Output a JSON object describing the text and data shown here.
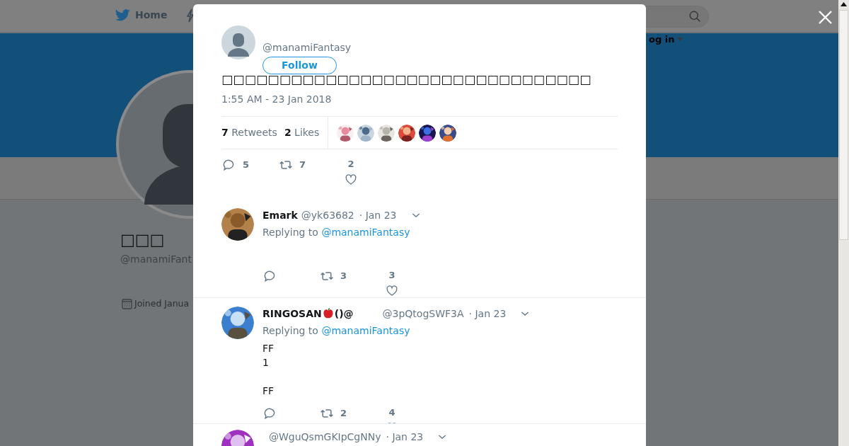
{
  "nav": {
    "home": "Home",
    "login": "og in"
  },
  "profile": {
    "name": "□□□",
    "handle": "@manamiFant",
    "joined": "Joined Janua"
  },
  "tweet": {
    "handle": "@manamiFantasy",
    "follow": "Follow",
    "text": "□□□□□□□□□□□□□□□□□□□□□□□□□□□□□□□□",
    "time": "1:55 AM - 23 Jan 2018",
    "stats": [
      {
        "count": "7",
        "label": "Retweets"
      },
      {
        "count": "2",
        "label": "Likes"
      }
    ],
    "actions": {
      "replies": "5",
      "retweets": "7",
      "likes": "2"
    }
  },
  "replies": [
    {
      "name": [
        "Emark"
      ],
      "handle": "@yk63682",
      "date": "· Jan 23",
      "replying_label": "Replying to",
      "replying_to": "@manamiFantasy",
      "actions": {
        "retweets": "3",
        "likes": "3"
      }
    },
    {
      "name": [
        "RINGOSAN",
        "()@"
      ],
      "handle": "@3pQtogSWF3A",
      "date": "· Jan 23",
      "replying_label": "Replying to",
      "replying_to": "@manamiFantasy",
      "text": "FF\n1\n\nFF",
      "actions": {
        "retweets": "2",
        "likes": "4"
      }
    },
    {
      "handle": "@WguQsmGKIpCgNNy",
      "date": "· Jan 23"
    }
  ]
}
